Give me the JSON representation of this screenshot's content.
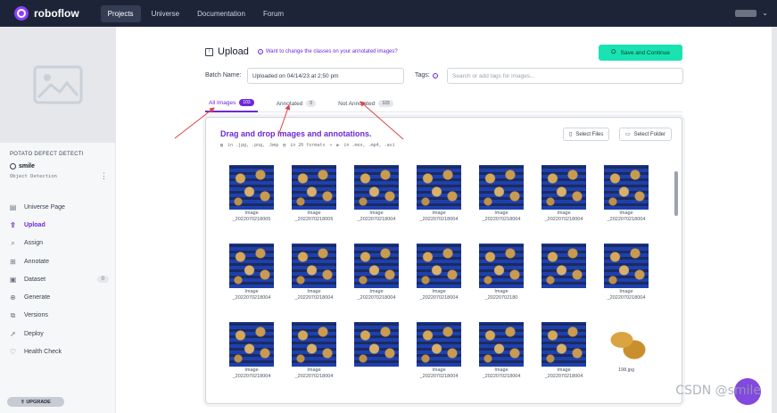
{
  "brand": {
    "name": "roboflow"
  },
  "topnav": {
    "items": [
      "Projects",
      "Universe",
      "Documentation",
      "Forum"
    ],
    "active": "Projects"
  },
  "project": {
    "name": "POTATO DEFECT DETECTI",
    "workspace": "smile",
    "type": "Object Detection"
  },
  "sidebar": {
    "items": [
      {
        "label": "Universe Page",
        "icon": "universe-icon"
      },
      {
        "label": "Upload",
        "icon": "upload-icon",
        "active": true
      },
      {
        "label": "Assign",
        "icon": "assign-icon"
      },
      {
        "label": "Annotate",
        "icon": "annotate-icon"
      },
      {
        "label": "Dataset",
        "icon": "dataset-icon",
        "badge": "0"
      },
      {
        "label": "Generate",
        "icon": "generate-icon"
      },
      {
        "label": "Versions",
        "icon": "versions-icon"
      },
      {
        "label": "Deploy",
        "icon": "deploy-icon"
      },
      {
        "label": "Health Check",
        "icon": "health-icon"
      }
    ],
    "upgrade_label": "UPGRADE"
  },
  "header": {
    "title": "Upload",
    "help_link": "Want to change the classes on your annotated images?",
    "save_label": "Save and Continue"
  },
  "batch": {
    "label": "Batch Name:",
    "value": "Uploaded on 04/14/23 at 2:50 pm"
  },
  "tags": {
    "label": "Tags:",
    "placeholder": "Search or add tags for images..."
  },
  "tabs": [
    {
      "label": "All Images",
      "count": "103"
    },
    {
      "label": "Annotated",
      "count": "0"
    },
    {
      "label": "Not Annotated",
      "count": "103"
    }
  ],
  "dropzone": {
    "title": "Drag and drop images and annotations.",
    "formats": [
      "in .jpg, .png, .bmp",
      "in 26 formats",
      "in .mov, .mp4, .avi"
    ],
    "select_files": "Select Files",
    "select_folder": "Select Folder"
  },
  "images": [
    [
      "Image",
      "_2022070218005",
      ""
    ],
    [
      "Image",
      "_2022070218005",
      ""
    ],
    [
      "Image",
      "_2022070218004",
      ""
    ],
    [
      "Image",
      "_2022070218004",
      ""
    ],
    [
      "Image",
      "_2022070218004",
      ""
    ],
    [
      "Image",
      "_2022070218004",
      ""
    ],
    [
      "Image",
      "_2022070218004",
      ""
    ],
    [
      "Image",
      "_2022070218004",
      ""
    ],
    [
      "Image",
      "_2022070218004",
      ""
    ],
    [
      "Image",
      "_2022070218004",
      ""
    ],
    [
      "Image",
      "_2022070218004",
      ""
    ],
    [
      "Image",
      "_20220702180",
      ""
    ],
    [
      "",
      "",
      ""
    ],
    [
      "Image",
      "_2022070218004",
      ""
    ],
    [
      "Image",
      "_2022070218004",
      ""
    ],
    [
      "Image",
      "_2022070218004",
      ""
    ],
    [
      "",
      "",
      ""
    ],
    [
      "Image",
      "_2022070218004",
      ""
    ],
    [
      "Image",
      "_2022070218004",
      ""
    ],
    [
      "Image",
      "_2022070218004",
      ""
    ],
    [
      "198.jpg",
      "",
      ""
    ]
  ],
  "watermark": "CSDN @smile"
}
